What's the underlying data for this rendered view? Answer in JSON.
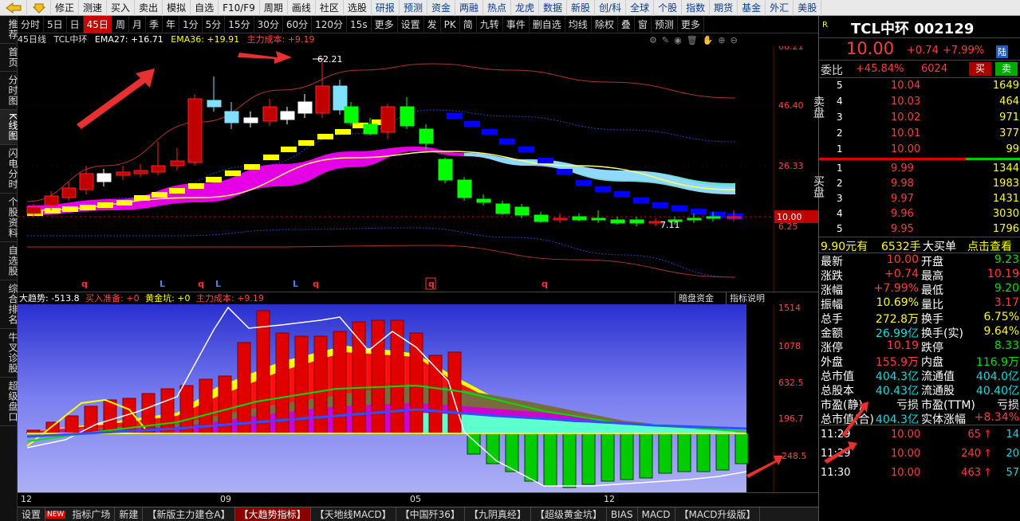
{
  "topbar": {
    "items": [
      "修正",
      "测速",
      "买入",
      "卖出",
      "模拟",
      "自选",
      "F10/F9",
      "周期",
      "画线",
      "社区",
      "选股",
      "研报",
      "预测",
      "资金",
      "两融",
      "热点",
      "龙虎",
      "数据",
      "新股",
      "创/科",
      "全球",
      "个股",
      "指数",
      "期货",
      "基金",
      "外汇",
      "美股"
    ]
  },
  "leftnav": [
    "推荐",
    "首页",
    "分时图",
    "K线图",
    "闪电分时",
    "个股资料",
    "自选股",
    "综合排名",
    "牛叉诊股",
    "超级盘口"
  ],
  "periodbar": [
    "分时",
    "5日",
    "日",
    "45日",
    "周",
    "月",
    "季",
    "年",
    "1分",
    "5分",
    "15分",
    "30分",
    "60分",
    "120分",
    "15s",
    "更多",
    "设置",
    "发",
    "PK",
    "简",
    "九转",
    "事件",
    "删自选",
    "均线",
    "除权",
    "叠",
    "窗",
    "预测",
    "更多"
  ],
  "periodbar_active": "45日",
  "info": {
    "period": "45日线",
    "name": "TCL中环",
    "ema27": "EMA27: +16.71",
    "ema36": "EMA36: +19.91",
    "cost": "主力成本: +9.19"
  },
  "main_axis": [
    "66.21",
    "46.40",
    "26.33",
    "6.25"
  ],
  "current_price_tag": "10.00",
  "annotations": {
    "high": "62.21",
    "low": "7.11"
  },
  "signal_marks": [
    "q",
    "L",
    "q",
    "L",
    "L",
    "q",
    "q",
    "q"
  ],
  "sub": {
    "name": "大趋势: -513.8",
    "buy": "买入准备: +0",
    "gold": "黄金坑: +0",
    "cost": "主力成本: +9.19",
    "btn_dark": "暗盘资金",
    "btn_help": "指标说明",
    "axis": [
      "1514",
      "1078",
      "632.5",
      "196.7",
      "-248.5"
    ]
  },
  "dates": [
    "12",
    "09",
    "05",
    "12"
  ],
  "bottomtabs": [
    "设置",
    "NEW",
    "指标广场",
    "新建",
    "【新版主力建仓A】",
    "【大趋势指标】",
    "【天地线MACD】",
    "【中国歼36】",
    "【九阴真经】",
    "【超级黄金坑】",
    "BIAS",
    "MACD",
    "【MACD升级版】"
  ],
  "bottomtabs_active": "【大趋势指标】",
  "quote": {
    "title": "TCL中环 002129",
    "price": "10.00",
    "change": "+0.74",
    "pct": "+7.99%",
    "market_tag": "陆",
    "webi_label": "委比",
    "webi": "+45.84%",
    "webi_vol": "6024",
    "buy_btn": "买",
    "sell_btn": "卖",
    "sell_side_label": "卖盘",
    "buy_side_label": "买盘",
    "asks": [
      {
        "lvl": "5",
        "price": "10.04",
        "vol": "1649"
      },
      {
        "lvl": "4",
        "price": "10.03",
        "vol": "464"
      },
      {
        "lvl": "3",
        "price": "10.02",
        "vol": "971"
      },
      {
        "lvl": "2",
        "price": "10.01",
        "vol": "377"
      },
      {
        "lvl": "1",
        "price": "10.00",
        "vol": "99"
      }
    ],
    "bids": [
      {
        "lvl": "1",
        "price": "9.99",
        "vol": "1344"
      },
      {
        "lvl": "2",
        "price": "9.98",
        "vol": "1983"
      },
      {
        "lvl": "3",
        "price": "9.97",
        "vol": "1431"
      },
      {
        "lvl": "4",
        "price": "9.96",
        "vol": "3030"
      },
      {
        "lvl": "5",
        "price": "9.95",
        "vol": "1796"
      }
    ],
    "bigorder": {
      "price": "9.90元有",
      "vol": "6532手",
      "label": "大买单",
      "link": "点击查看"
    },
    "stats": [
      [
        "最新",
        "10.00",
        "开盘",
        "9.23"
      ],
      [
        "涨跌",
        "+0.74",
        "最高",
        "10.19"
      ],
      [
        "涨幅",
        "+7.99%",
        "最低",
        "9.20"
      ],
      [
        "振幅",
        "10.69%",
        "量比",
        "3.17"
      ],
      [
        "总手",
        "272.8万",
        "换手",
        "6.75%"
      ],
      [
        "金额",
        "26.99亿",
        "换手(实)",
        "9.64%"
      ],
      [
        "涨停",
        "10.19",
        "跌停",
        "8.33"
      ],
      [
        "外盘",
        "155.9万",
        "内盘",
        "116.9万"
      ],
      [
        "总市值",
        "404.3亿",
        "流通值",
        "404.0亿"
      ],
      [
        "总股本",
        "40.43亿",
        "流通股",
        "40.40亿"
      ],
      [
        "市盈(静)",
        "亏损",
        "市盈(TTM)",
        "亏损"
      ],
      [
        "总市值(合)",
        "404.3亿",
        "实体涨幅",
        "+8.34%"
      ]
    ],
    "ticks": [
      {
        "time": "11:29",
        "price": "10.00",
        "vol": "65",
        "n": "14"
      },
      {
        "time": "11:29",
        "price": "10.00",
        "vol": "240",
        "n": "20"
      },
      {
        "time": "11:30",
        "price": "10.00",
        "vol": "463",
        "n": "57"
      }
    ]
  },
  "colors": {
    "up": "#ff3b3b",
    "down": "#00e000",
    "accent": "#c00000",
    "highlight": "#ffff00"
  }
}
